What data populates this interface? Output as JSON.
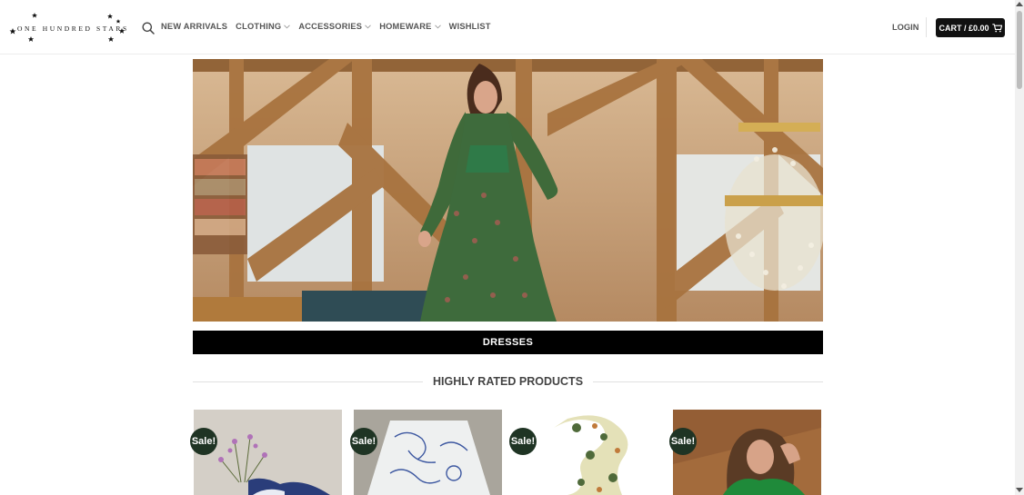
{
  "header": {
    "logo_text": "ONE HUNDRED STARS",
    "nav": [
      {
        "label": "NEW ARRIVALS",
        "dropdown": false
      },
      {
        "label": "CLOTHING",
        "dropdown": true
      },
      {
        "label": "ACCESSORIES",
        "dropdown": true
      },
      {
        "label": "HOMEWARE",
        "dropdown": true
      },
      {
        "label": "WISHLIST",
        "dropdown": false
      }
    ],
    "login_label": "LOGIN",
    "cart_label": "CART / £0.00"
  },
  "hero": {
    "banner_label": "DRESSES"
  },
  "section": {
    "title": "HIGHLY RATED PRODUCTS"
  },
  "products": [
    {
      "badge": "Sale!",
      "image": "flower-vase-photo"
    },
    {
      "badge": "Sale!",
      "image": "lampshade-photo"
    },
    {
      "badge": "Sale!",
      "image": "scarf-photo"
    },
    {
      "badge": "Sale!",
      "image": "model-green-scarf-photo"
    }
  ],
  "icons": {
    "search": "search-icon",
    "cart": "cart-icon",
    "chevron": "chevron-down-icon"
  },
  "colors": {
    "cart_bg": "#111111",
    "banner_bg": "#000000",
    "sale_badge": "#1f3424"
  }
}
